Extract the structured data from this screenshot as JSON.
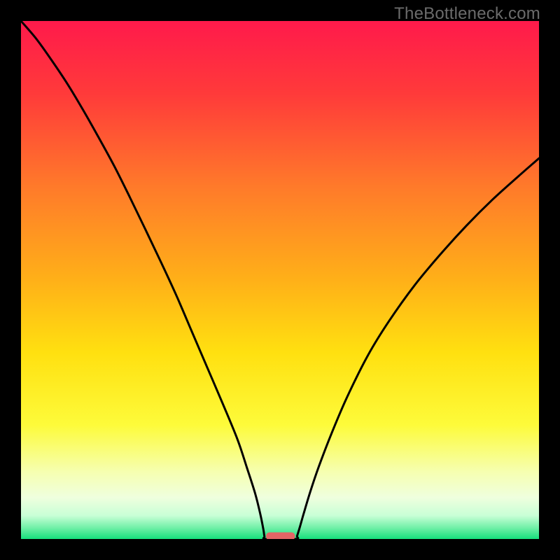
{
  "watermark": "TheBottleneck.com",
  "colors": {
    "frame": "#000000",
    "curve": "#000000",
    "marker": "#e36565",
    "gradient_stops": [
      {
        "offset": 0.0,
        "color": "#ff1a4b"
      },
      {
        "offset": 0.14,
        "color": "#ff3a3a"
      },
      {
        "offset": 0.32,
        "color": "#ff7a2a"
      },
      {
        "offset": 0.5,
        "color": "#ffb018"
      },
      {
        "offset": 0.64,
        "color": "#ffe010"
      },
      {
        "offset": 0.78,
        "color": "#fdfb3a"
      },
      {
        "offset": 0.87,
        "color": "#f6ffb0"
      },
      {
        "offset": 0.92,
        "color": "#efffde"
      },
      {
        "offset": 0.955,
        "color": "#c8ffd6"
      },
      {
        "offset": 0.978,
        "color": "#72f0a8"
      },
      {
        "offset": 1.0,
        "color": "#16e07c"
      }
    ]
  },
  "chart_data": {
    "type": "line",
    "title": "",
    "xlabel": "",
    "ylabel": "",
    "xlim": [
      0,
      100
    ],
    "ylim": [
      0,
      100
    ],
    "grid": false,
    "series": [
      {
        "name": "bottleneck-curve",
        "x": [
          0,
          3,
          6,
          9,
          12,
          15,
          18,
          21,
          24,
          27,
          30,
          33,
          36,
          39,
          41.8,
          43.6,
          45.2,
          46.2,
          46.8,
          47.0,
          47.3,
          53.0,
          53.3,
          53.8,
          54.6,
          55.9,
          57.5,
          60.0,
          63.0,
          67.0,
          71.0,
          76.0,
          81.0,
          86.0,
          91.0,
          96.0,
          100.0
        ],
        "values": [
          100,
          96.5,
          92.3,
          87.8,
          82.8,
          77.5,
          72.0,
          66.0,
          59.8,
          53.5,
          47.0,
          40.0,
          33.0,
          26.0,
          19.2,
          13.8,
          8.8,
          4.8,
          1.8,
          0.5,
          0.0,
          0.0,
          0.6,
          2.2,
          5.0,
          9.3,
          14.0,
          20.5,
          27.5,
          35.5,
          42.0,
          49.0,
          55.0,
          60.5,
          65.5,
          70.0,
          73.5
        ]
      }
    ],
    "marker": {
      "x_center": 50.1,
      "width": 5.6,
      "y": 0.6
    },
    "background_gradient_axis": "y"
  }
}
